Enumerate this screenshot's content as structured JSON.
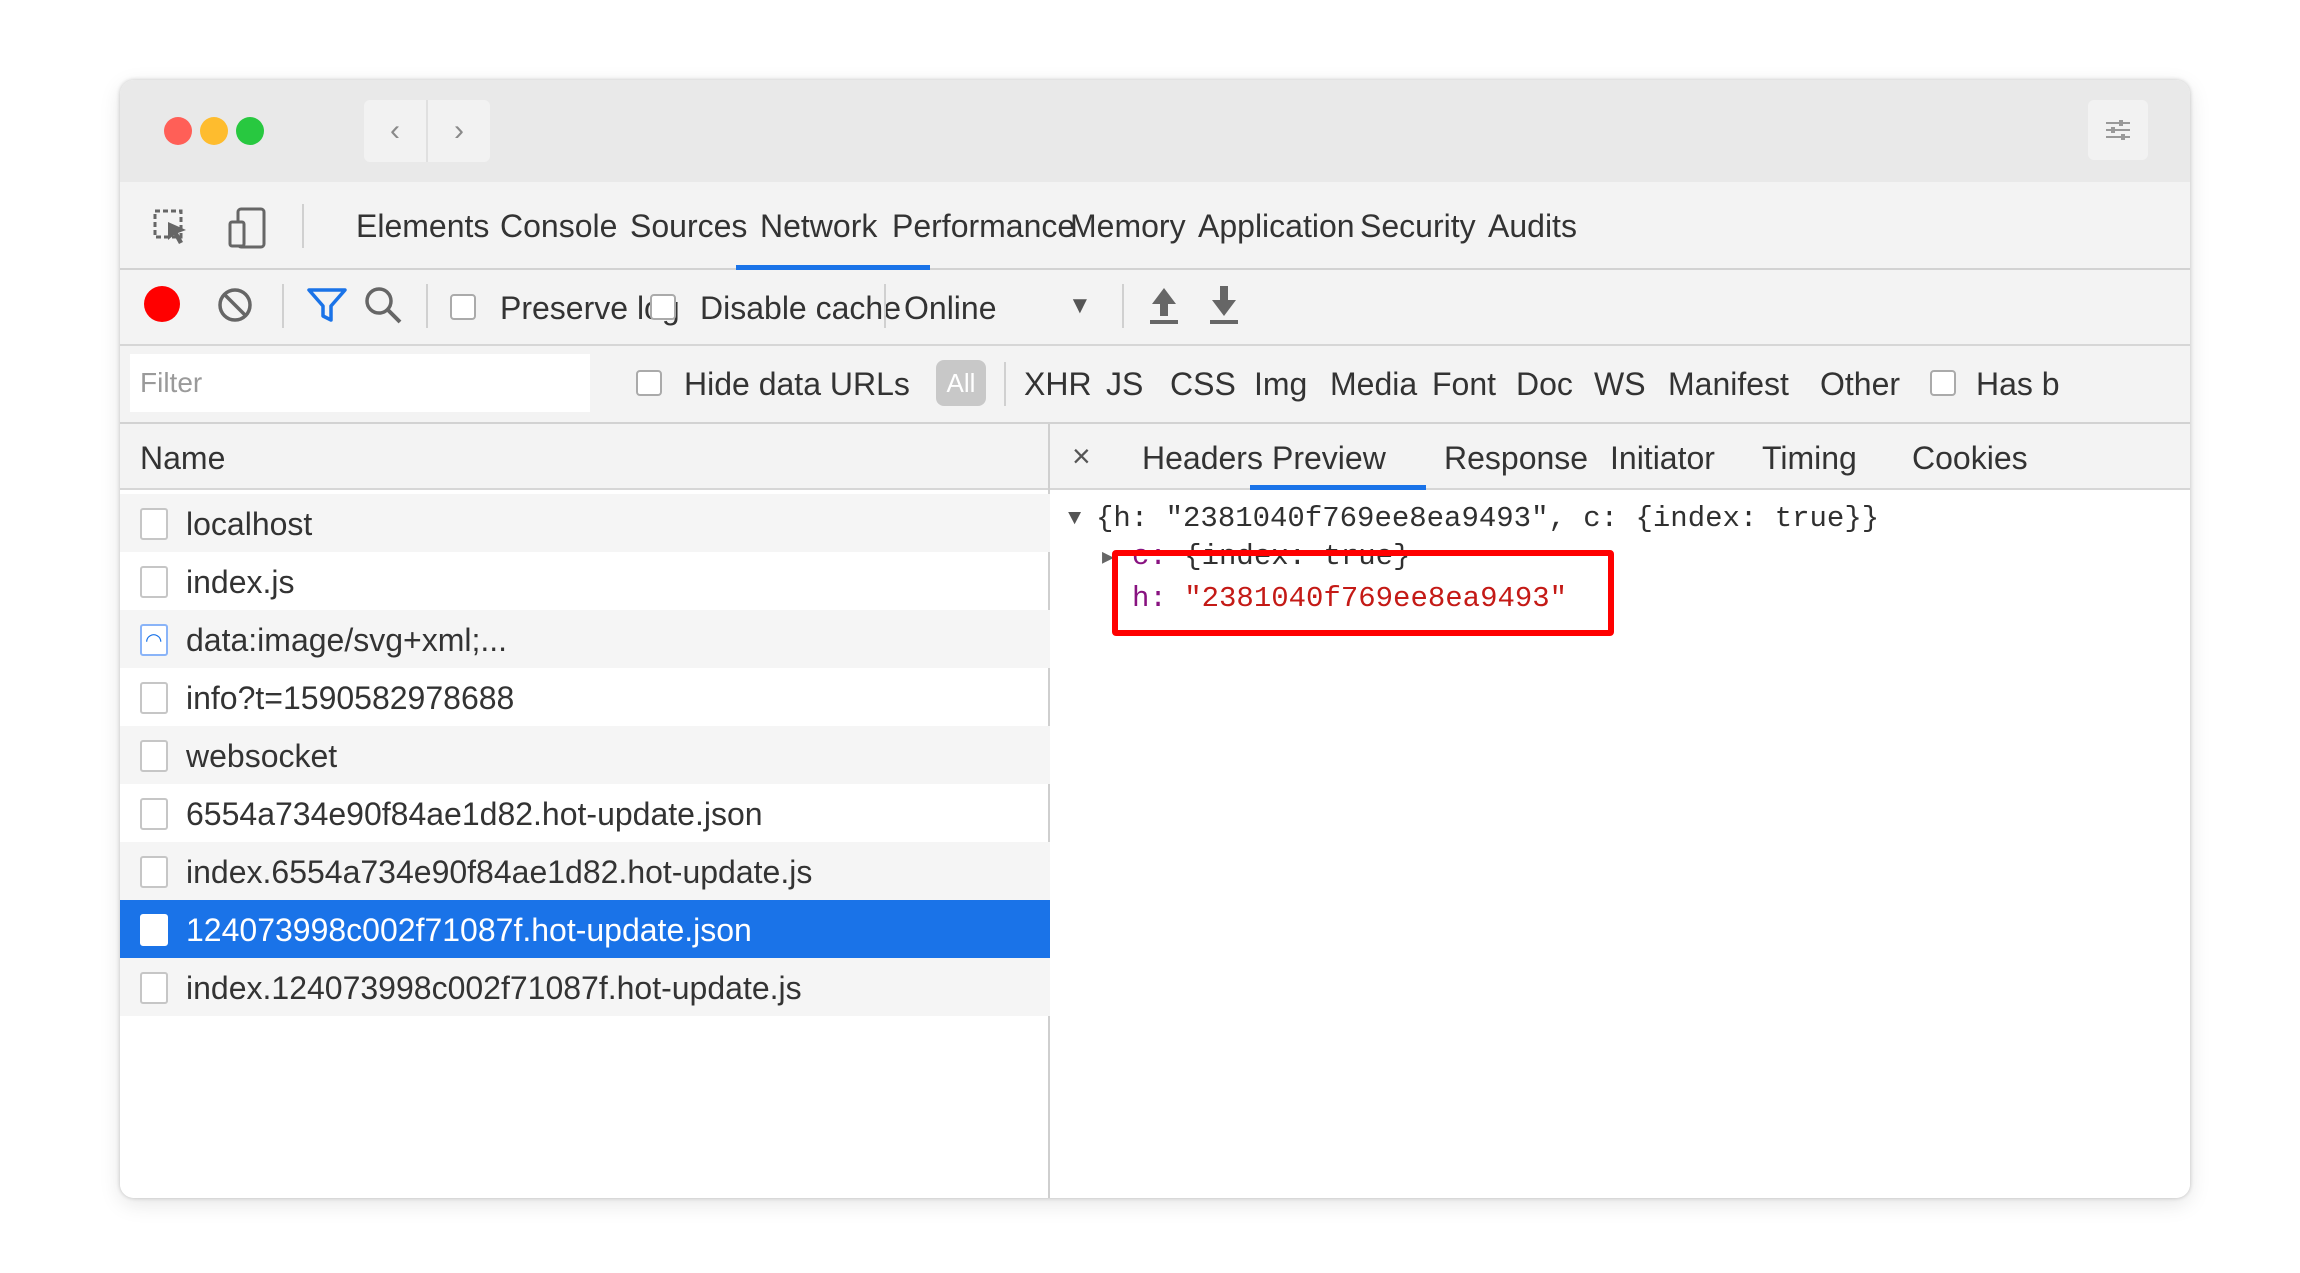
{
  "window": {
    "traffic_lights": {
      "close": "#ff5f57",
      "minimize": "#febc2e",
      "maximize": "#28c840"
    },
    "nav": {
      "back_icon": "chevron-left-icon",
      "forward_icon": "chevron-right-icon"
    },
    "menu_icon": "sliders-icon"
  },
  "devtools": {
    "tabs": [
      "Elements",
      "Console",
      "Sources",
      "Network",
      "Performance",
      "Memory",
      "Application",
      "Security",
      "Audits"
    ],
    "active_tab": "Network",
    "accent": "#1a73e8"
  },
  "toolbar": {
    "preserve_log": "Preserve log",
    "disable_cache": "Disable cache",
    "throttling": "Online",
    "record_color": "#ff0000",
    "filter_icon_color": "#1a73e8"
  },
  "filterbar": {
    "placeholder": "Filter",
    "hide_data_urls": "Hide data URLs",
    "all": "All",
    "types": [
      "XHR",
      "JS",
      "CSS",
      "Img",
      "Media",
      "Font",
      "Doc",
      "WS",
      "Manifest",
      "Other"
    ],
    "has_blocked": "Has b"
  },
  "requests": {
    "column_name": "Name",
    "items": [
      "localhost",
      "index.js",
      "data:image/svg+xml;...",
      "info?t=1590582978688",
      "websocket",
      "6554a734e90f84ae1d82.hot-update.json",
      "index.6554a734e90f84ae1d82.hot-update.js",
      "124073998c002f71087f.hot-update.json",
      "index.124073998c002f71087f.hot-update.js"
    ],
    "selected_index": 7
  },
  "detail": {
    "close": "×",
    "tabs": [
      "Headers",
      "Preview",
      "Response",
      "Initiator",
      "Timing",
      "Cookies"
    ],
    "active_tab": "Preview",
    "preview": {
      "root_line": "{h: \"2381040f769ee8ea9493\", c: {index: true}}",
      "c_key": "c:",
      "c_value": "{index: true}",
      "h_key": "h:",
      "h_value": "\"2381040f769ee8ea9493\""
    },
    "highlight_color": "#ff0000"
  }
}
